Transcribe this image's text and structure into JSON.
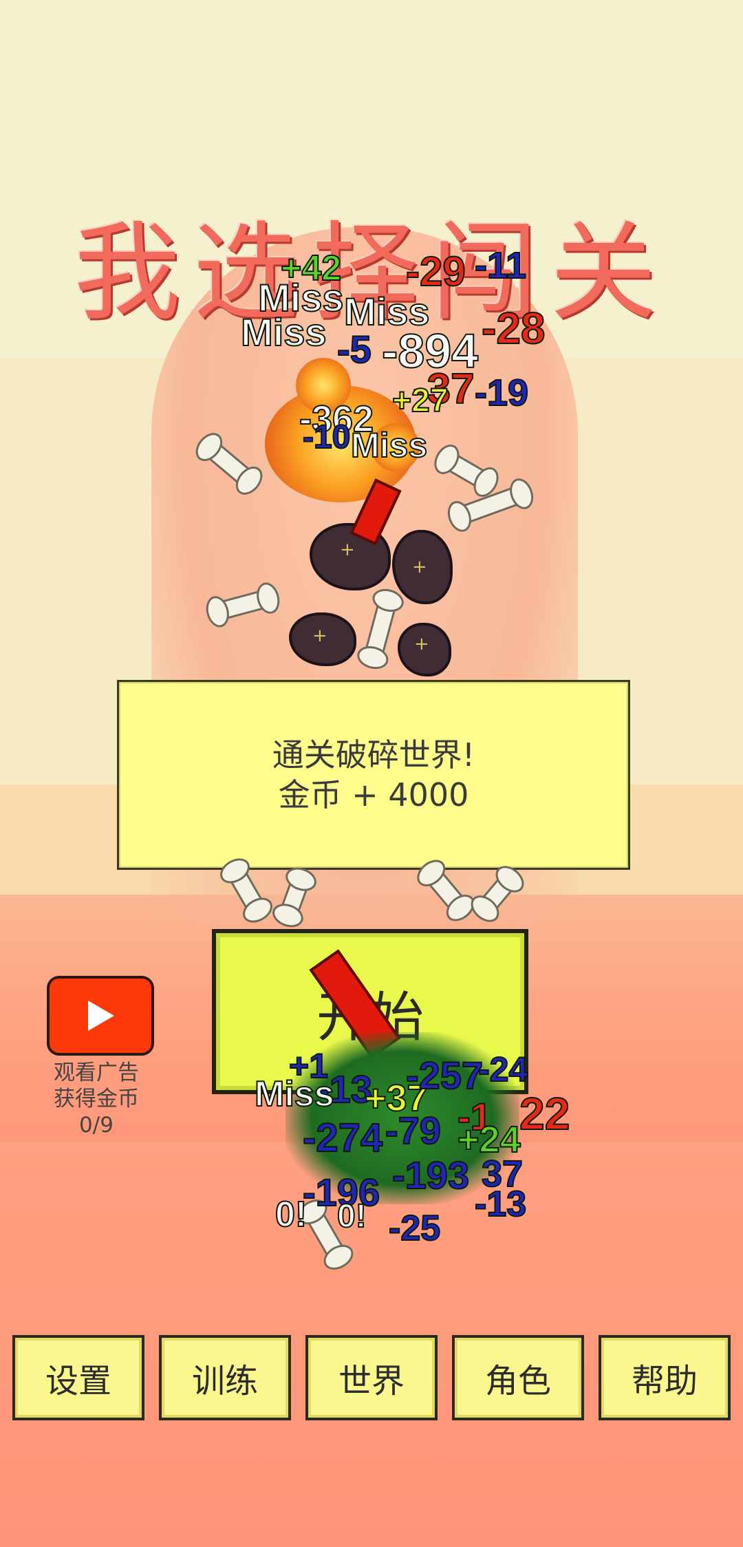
{
  "title": "我选择闯关",
  "message": {
    "line1": "通关破碎世界!",
    "line2": "金币 + 4000"
  },
  "start_button": "开始",
  "ad": {
    "line1": "观看广告",
    "line2": "获得金币",
    "counter": "0/9"
  },
  "menu": [
    "设置",
    "训练",
    "世界",
    "角色",
    "帮助"
  ],
  "damage_numbers_top": [
    "+42",
    "-29",
    "-11",
    "Miss",
    "Miss",
    "Miss",
    "-5",
    "-894",
    "-28",
    "-37",
    "-19",
    "-362",
    "-10",
    "Miss",
    "+27"
  ],
  "damage_numbers_bottom": [
    "+1",
    "-13",
    "+37",
    "-257",
    "-24",
    "-1",
    "22",
    "-274",
    "-79",
    "+24",
    "-193",
    "37",
    "-196",
    "-13",
    "-25",
    "Miss",
    "0!",
    "0!"
  ],
  "colors": {
    "accent_red": "#f26a5b",
    "panel_yellow": "#fffd8c",
    "start_green_yellow": "#e8f94b",
    "ad_red": "#ff3a0a"
  },
  "icons": {
    "ad": "play-icon"
  }
}
